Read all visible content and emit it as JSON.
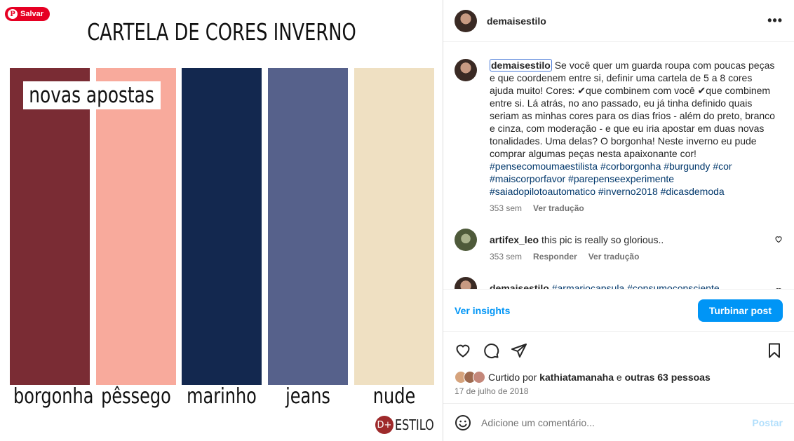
{
  "image": {
    "save_button": "Salvar",
    "title": "CARTELA DE CORES INVERNO",
    "badge": "novas apostas",
    "logo_text": "ESTILO",
    "logo_mark": "D+",
    "colors": [
      {
        "label": "borgonha",
        "hex": "#7a2c34"
      },
      {
        "label": "pêssego",
        "hex": "#f8aa9c"
      },
      {
        "label": "marinho",
        "hex": "#13284f"
      },
      {
        "label": "jeans",
        "hex": "#56618b"
      },
      {
        "label": "nude",
        "hex": "#efe0c2"
      }
    ]
  },
  "header": {
    "username": "demaisestilo",
    "more": "•••"
  },
  "caption": {
    "username": "demaisestilo",
    "text": "Se você quer um guarda roupa com poucas peças e que coordenem entre si, definir uma cartela de 5 a 8 cores ajuda muito! Cores: ✔que combinem com você ✔que combinem entre si. Lá atrás, no ano passado, eu já tinha definido quais seriam as minhas cores para os dias frios - além do preto, branco e cinza, com moderação - e que eu iria apostar em duas novas tonalidades. Uma delas? O borgonha! Neste inverno eu pude comprar algumas peças nesta apaixonante cor!",
    "hashtags": "#pensecomoumaestilista #corborgonha #burgundy #cor #maiscorporfavor #parepenseexperimente #saiadopilotoautomatico #inverno2018 #dicasdemoda",
    "time": "353 sem",
    "translate": "Ver tradução"
  },
  "comments": [
    {
      "username": "artifex_leo",
      "text": "this pic is really so glorious..",
      "time": "353 sem",
      "reply": "Responder",
      "translate": "Ver tradução"
    },
    {
      "username": "demaisestilo",
      "text": "#armariocapsula #consumoconsciente"
    }
  ],
  "insights": {
    "link": "Ver insights",
    "boost": "Turbinar post"
  },
  "likes": {
    "prefix": "Curtido por",
    "user": "kathiatamanaha",
    "middle": "e",
    "others": "outras 63 pessoas"
  },
  "date": "17 de julho de 2018",
  "comment_input": {
    "placeholder": "Adicione um comentário...",
    "post": "Postar"
  }
}
